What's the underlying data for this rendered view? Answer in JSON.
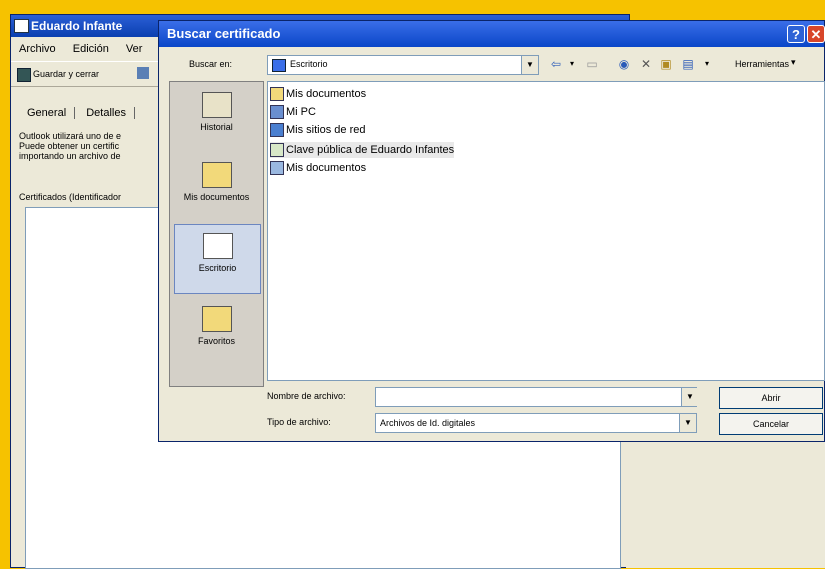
{
  "background_window": {
    "title": "Eduardo Infante",
    "menu": [
      "Archivo",
      "Edición",
      "Ver"
    ],
    "toolbar": {
      "save_label": "Guardar y cerrar"
    },
    "tabs": [
      "General",
      "Detalles"
    ],
    "description_lines": [
      "Outlook utilizará uno de e",
      "Puede obtener un certific",
      "importando un archivo de"
    ],
    "certificates_label": "Certificados (Identificador"
  },
  "dialog": {
    "title": "Buscar certificado",
    "look_in_label": "Buscar en:",
    "look_in_value": "Escritorio",
    "tools_label": "Herramientas",
    "places": [
      {
        "label": "Historial",
        "icon": "history-icon"
      },
      {
        "label": "Mis documentos",
        "icon": "my-documents-icon"
      },
      {
        "label": "Escritorio",
        "icon": "desktop-icon",
        "selected": true
      },
      {
        "label": "Favoritos",
        "icon": "favorites-icon"
      }
    ],
    "files": [
      {
        "name": "Mis documentos",
        "icon": "my-documents-icon"
      },
      {
        "name": "Mi PC",
        "icon": "my-computer-icon"
      },
      {
        "name": "Mis sitios de red",
        "icon": "network-places-icon"
      },
      {
        "name": "Clave pública de Eduardo Infantes",
        "icon": "certificate-file-icon",
        "selected": true
      },
      {
        "name": "Mis documentos",
        "icon": "my-documents-icon"
      }
    ],
    "file_name_label": "Nombre de archivo:",
    "file_name_value": "",
    "file_type_label": "Tipo de archivo:",
    "file_type_value": "Archivos de Id. digitales",
    "open_button": "Abrir",
    "cancel_button": "Cancelar"
  },
  "colors": {
    "background": "#f6c200",
    "titlebar": "#0a46c8",
    "window": "#ece9d8"
  }
}
